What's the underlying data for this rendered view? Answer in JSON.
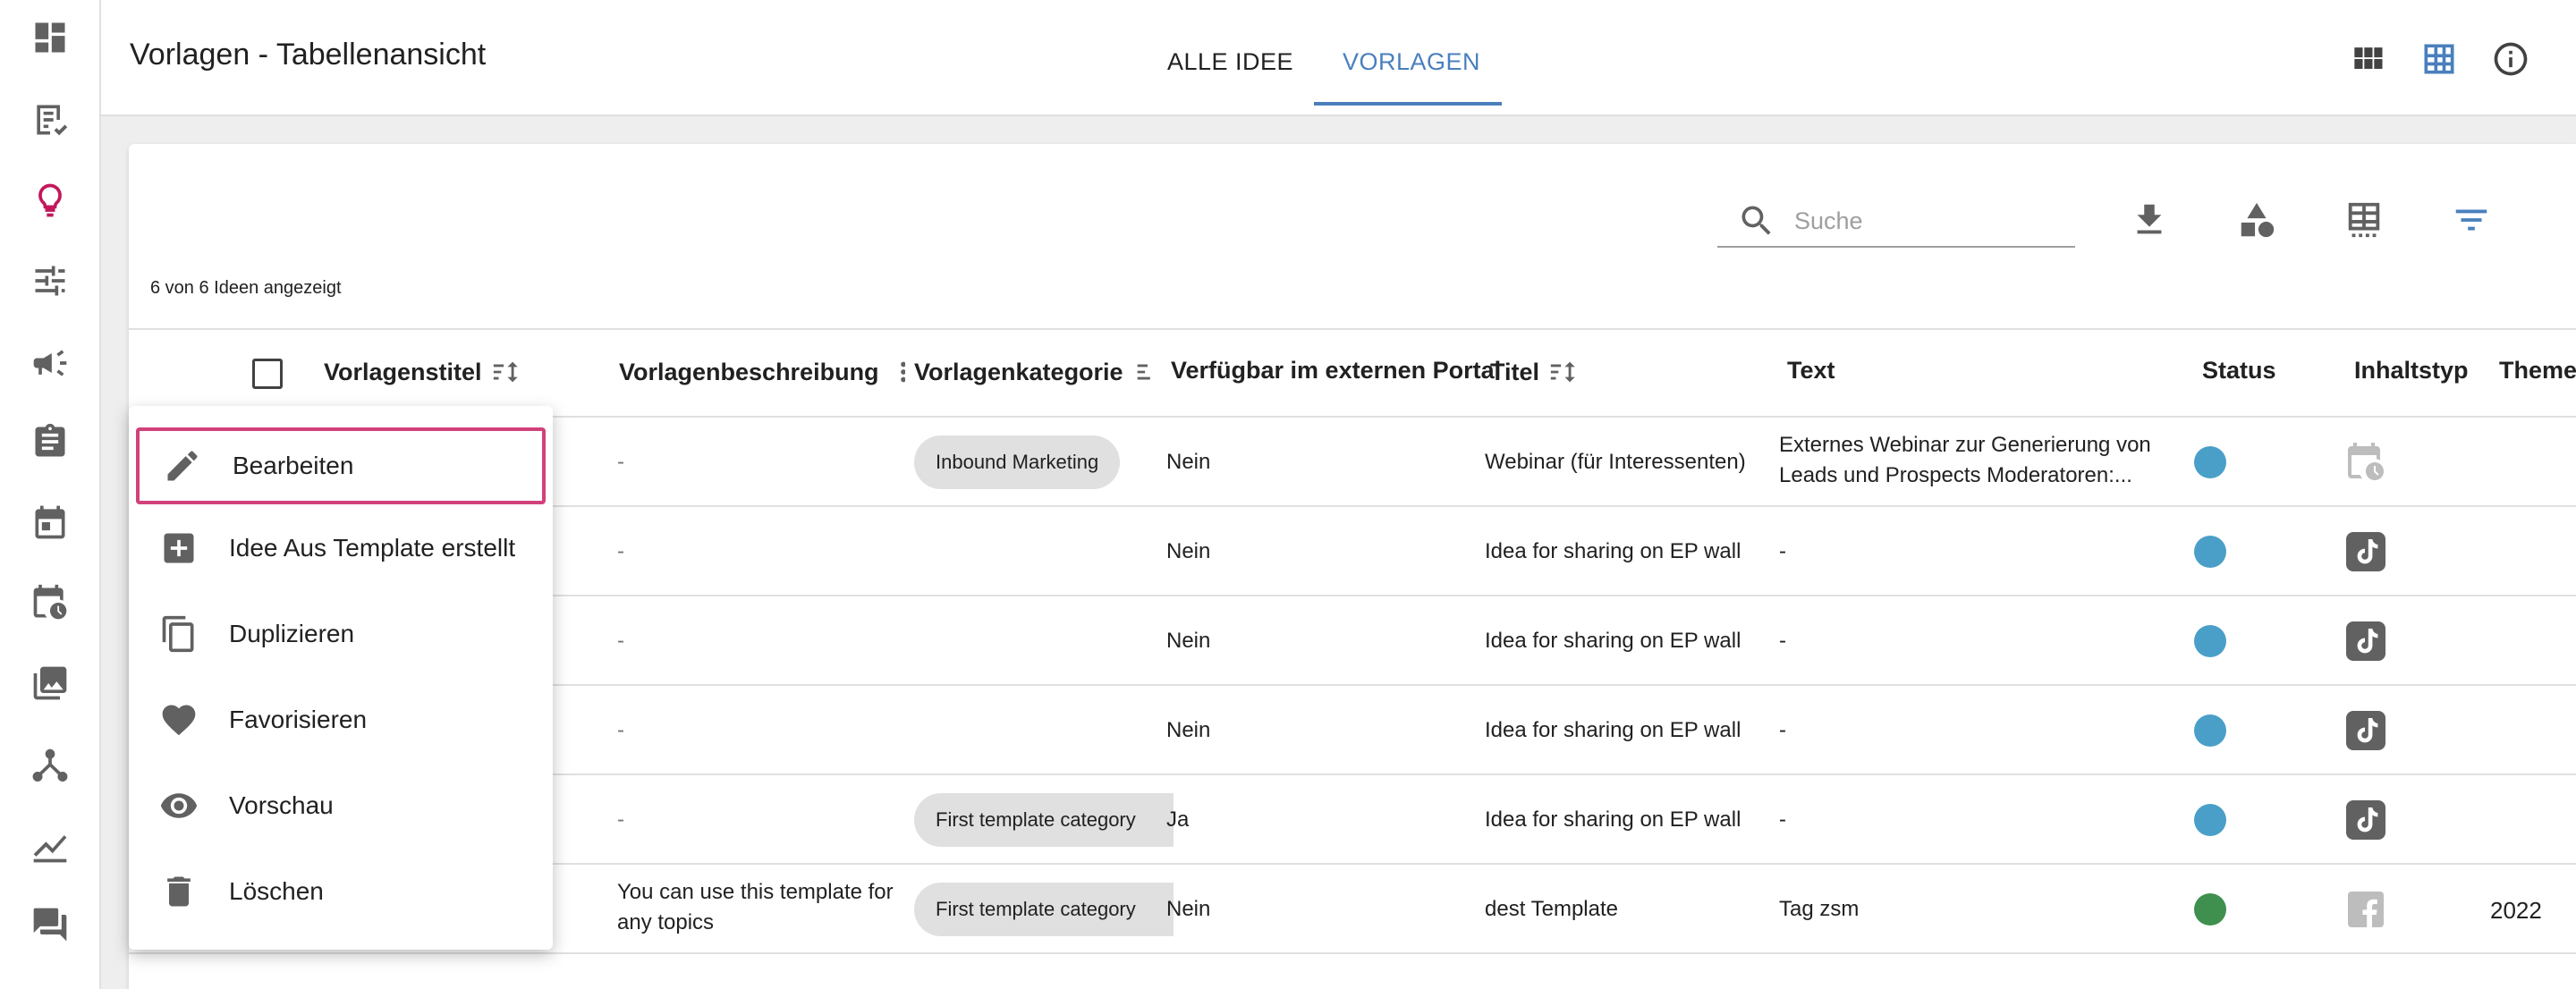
{
  "header": {
    "title": "Vorlagen - Tabellenansicht",
    "tabs": [
      {
        "label": "ALLE IDEE"
      },
      {
        "label": "VORLAGEN"
      }
    ]
  },
  "toolbar": {
    "search_placeholder": "Suche",
    "count_text": "6 von 6 Ideen angezeigt"
  },
  "table": {
    "columns": [
      "Vorlagenstitel",
      "Vorlagenbeschreibung",
      "Vorlagenkategorie",
      "Verfügbar im externen Portal",
      "Titel",
      "Text",
      "Status",
      "Inhaltstyp",
      "Themen"
    ],
    "rows": [
      {
        "beschreibung": "-",
        "kategorie": "Inbound Marketing",
        "verfuegbar": "Nein",
        "titel": "Webinar (für Interessenten)",
        "text": "Externes Webinar zur Generierung von Leads und Prospects  Moderatoren:...",
        "status_color": "#4a9fc8",
        "inhaltstyp": "calendar-clock-icon",
        "themen": ""
      },
      {
        "beschreibung": "-",
        "kategorie": "",
        "verfuegbar": "Nein",
        "titel": "Idea for sharing on EP wall",
        "text": "-",
        "status_color": "#4a9fc8",
        "inhaltstyp": "tiktok-icon",
        "themen": ""
      },
      {
        "beschreibung": "-",
        "kategorie": "",
        "verfuegbar": "Nein",
        "titel": "Idea for sharing on EP wall",
        "text": "-",
        "status_color": "#4a9fc8",
        "inhaltstyp": "tiktok-icon",
        "themen": ""
      },
      {
        "beschreibung": "-",
        "kategorie": "",
        "verfuegbar": "Nein",
        "titel": "Idea for sharing on EP wall",
        "text": "-",
        "status_color": "#4a9fc8",
        "inhaltstyp": "tiktok-icon",
        "themen": ""
      },
      {
        "beschreibung": "-",
        "kategorie": "First template category",
        "verfuegbar": "Ja",
        "titel": "Idea for sharing on EP wall",
        "text": "-",
        "status_color": "#4a9fc8",
        "inhaltstyp": "tiktok-icon",
        "themen": ""
      },
      {
        "beschreibung": "You can use this template for any topics",
        "kategorie": "First template category",
        "verfuegbar": "Nein",
        "titel": "dest Template",
        "text": "Tag zsm",
        "status_color": "#3f8f4f",
        "inhaltstyp": "facebook-icon",
        "themen": "2022"
      }
    ]
  },
  "context_menu": {
    "items": [
      {
        "label": "Bearbeiten",
        "icon": "pencil-icon"
      },
      {
        "label": "Idee Aus Template erstellt",
        "icon": "plus-box-icon"
      },
      {
        "label": "Duplizieren",
        "icon": "copy-icon"
      },
      {
        "label": "Favorisieren",
        "icon": "heart-icon"
      },
      {
        "label": "Vorschau",
        "icon": "eye-icon"
      },
      {
        "label": "Löschen",
        "icon": "trash-icon"
      }
    ]
  },
  "colors": {
    "accent": "#4a7fbd",
    "highlight": "#d1417a",
    "sidebar_active": "#c2185b"
  }
}
